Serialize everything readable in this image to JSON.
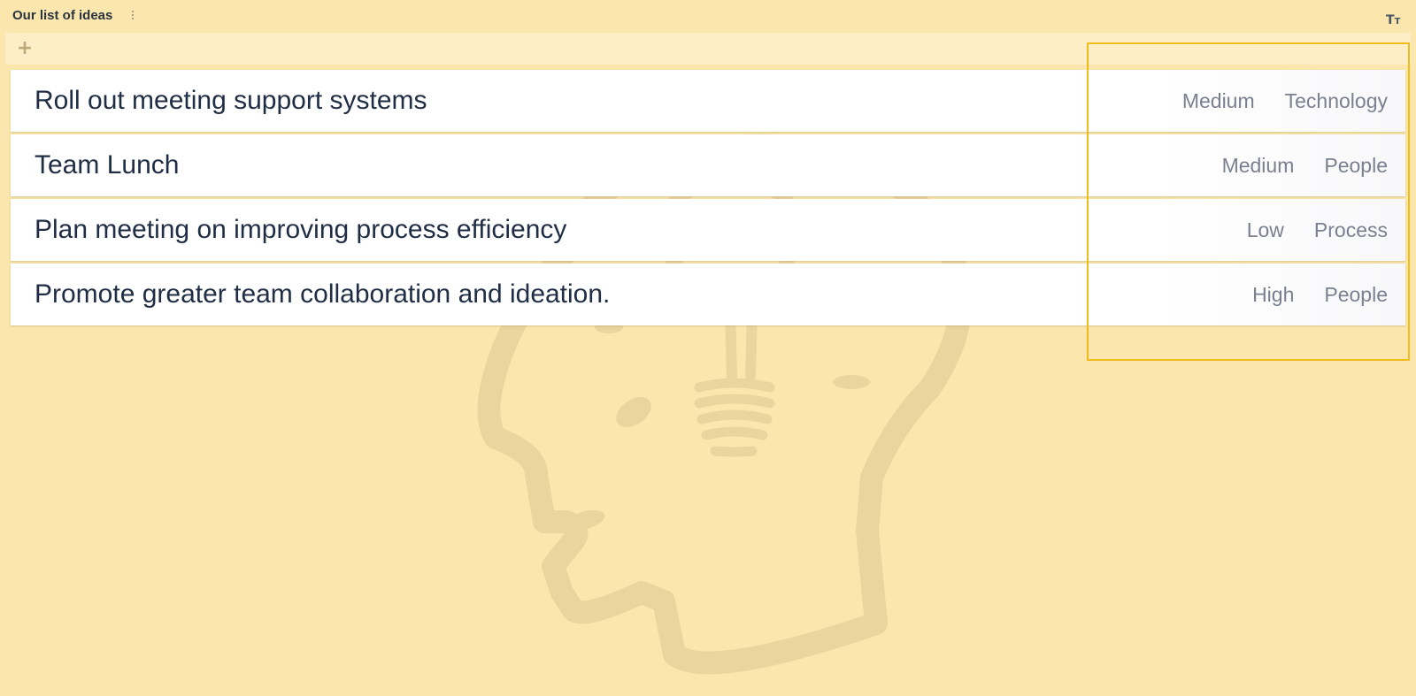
{
  "board": {
    "title": "Our list of ideas",
    "menu_icon": "vertical-dots-icon",
    "text_size_icon": "text-size-icon",
    "text_size_glyph_large": "T",
    "text_size_glyph_small": "T",
    "add_icon": "plus-icon",
    "add_glyph": "+"
  },
  "ideas": [
    {
      "title": "Roll out meeting support systems",
      "priority": "Medium",
      "category": "Technology"
    },
    {
      "title": "Team Lunch",
      "priority": "Medium",
      "category": "People"
    },
    {
      "title": "Plan meeting on improving process efficiency",
      "priority": "Low",
      "category": "Process"
    },
    {
      "title": "Promote greater team collaboration and ideation.",
      "priority": "High",
      "category": "People"
    }
  ],
  "background_illustration": "head-with-lightbulb",
  "colors": {
    "background": "#fbe7ad",
    "add_bar": "#fdeec8",
    "highlight": "#f0bc1d",
    "title_text": "#1f2d45",
    "tag_text": "#7b8090"
  }
}
